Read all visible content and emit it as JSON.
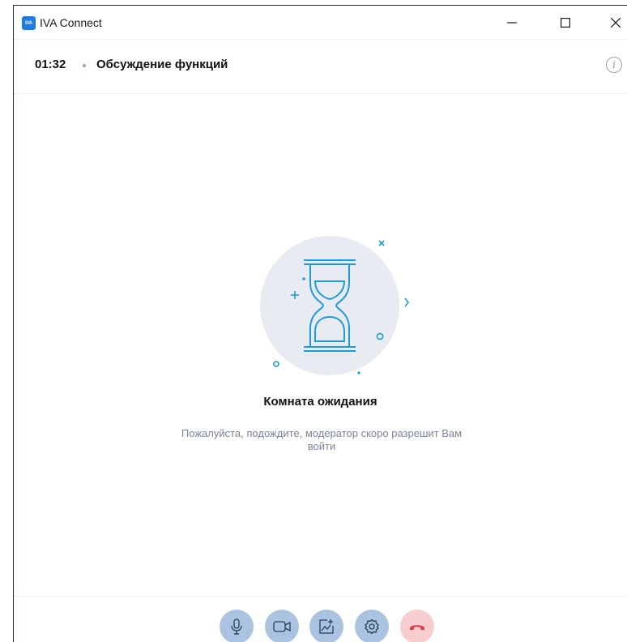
{
  "app": {
    "title": "IVA Connect",
    "logo_text": "IVA"
  },
  "window_controls": {
    "minimize": "minimize-icon",
    "maximize": "maximize-icon",
    "close": "close-icon"
  },
  "call": {
    "timer": "01:32",
    "title": "Обсуждение функций",
    "info_icon": "i"
  },
  "waiting_room": {
    "title": "Комната ожидания",
    "message": "Пожалуйста, подождите, модератор скоро разрешит Вам войти",
    "illustration_icon": "hourglass-icon"
  },
  "toolbar": {
    "buttons": [
      {
        "icon": "microphone-icon"
      },
      {
        "icon": "camera-icon"
      },
      {
        "icon": "screen-share-icon"
      },
      {
        "icon": "settings-icon"
      },
      {
        "icon": "hang-up-icon"
      }
    ]
  },
  "colors": {
    "brand": "#1c7ae0",
    "accent": "#1e9bd7",
    "control_bg": "#a9c3e0",
    "hangup_bg": "#f7cdd0",
    "hangup_icon": "#e53945",
    "muted_text": "#7a8599"
  }
}
